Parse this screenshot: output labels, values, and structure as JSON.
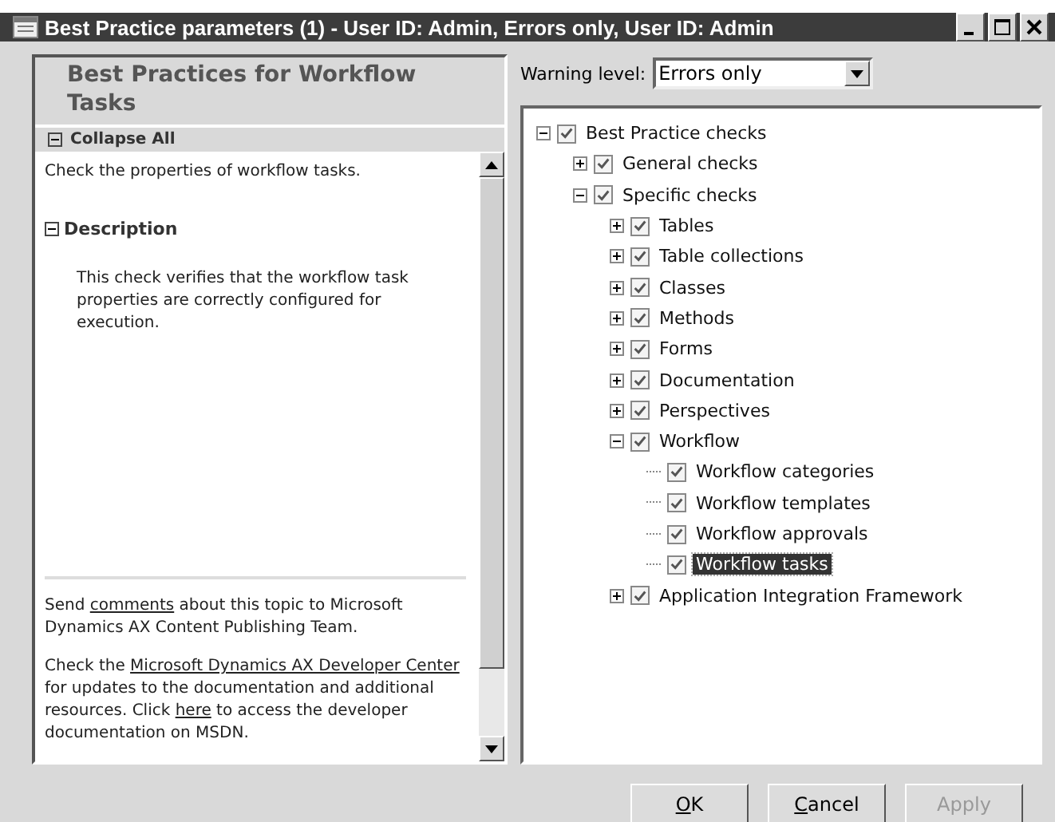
{
  "window": {
    "title": "Best Practice parameters (1) - User ID: Admin, Errors only, User ID: Admin"
  },
  "help": {
    "heading": "Best Practices for Workflow Tasks",
    "collapse_all": "Collapse All",
    "summary": "Check the properties of workflow tasks.",
    "section": {
      "title": "Description",
      "expanded": true,
      "text": "This check verifies that the workflow task properties are correctly configured for execution."
    },
    "footer": [
      [
        {
          "kind": "text",
          "text": "Send "
        },
        {
          "kind": "link",
          "text": "comments"
        },
        {
          "kind": "text",
          "text": " about this topic to Microsoft Dynamics AX Content Publishing Team."
        }
      ],
      [
        {
          "kind": "text",
          "text": "Check the "
        },
        {
          "kind": "link",
          "text": "Microsoft Dynamics AX Developer Center"
        },
        {
          "kind": "text",
          "text": " for updates to the documentation and additional resources. Click "
        },
        {
          "kind": "link",
          "text": "here"
        },
        {
          "kind": "text",
          "text": " to access the developer documentation on MSDN."
        }
      ]
    ]
  },
  "warning_level": {
    "label": "Warning level:",
    "value": "Errors only"
  },
  "tree": [
    {
      "label": "Best Practice checks",
      "checked": true,
      "expanded": true,
      "selected": false,
      "children": [
        {
          "label": "General checks",
          "checked": true,
          "expanded": false,
          "selected": false
        },
        {
          "label": "Specific checks",
          "checked": true,
          "expanded": true,
          "selected": false,
          "children": [
            {
              "label": "Tables",
              "checked": true,
              "expanded": false,
              "selected": false
            },
            {
              "label": "Table collections",
              "checked": true,
              "expanded": false,
              "selected": false
            },
            {
              "label": "Classes",
              "checked": true,
              "expanded": false,
              "selected": false
            },
            {
              "label": "Methods",
              "checked": true,
              "expanded": false,
              "selected": false
            },
            {
              "label": "Forms",
              "checked": true,
              "expanded": false,
              "selected": false
            },
            {
              "label": "Documentation",
              "checked": true,
              "expanded": false,
              "selected": false
            },
            {
              "label": "Perspectives",
              "checked": true,
              "expanded": false,
              "selected": false
            },
            {
              "label": "Workflow",
              "checked": true,
              "expanded": true,
              "selected": false,
              "children": [
                {
                  "label": "Workflow categories",
                  "checked": true,
                  "selected": false
                },
                {
                  "label": "Workflow templates",
                  "checked": true,
                  "selected": false
                },
                {
                  "label": "Workflow approvals",
                  "checked": true,
                  "selected": false
                },
                {
                  "label": "Workflow tasks",
                  "checked": true,
                  "selected": true
                }
              ]
            },
            {
              "label": "Application Integration Framework",
              "checked": true,
              "expanded": false,
              "selected": false
            }
          ]
        }
      ]
    }
  ],
  "buttons": [
    {
      "label": "OK",
      "disabled": false
    },
    {
      "label": "Cancel",
      "disabled": false
    },
    {
      "label": "Apply",
      "disabled": true
    }
  ]
}
